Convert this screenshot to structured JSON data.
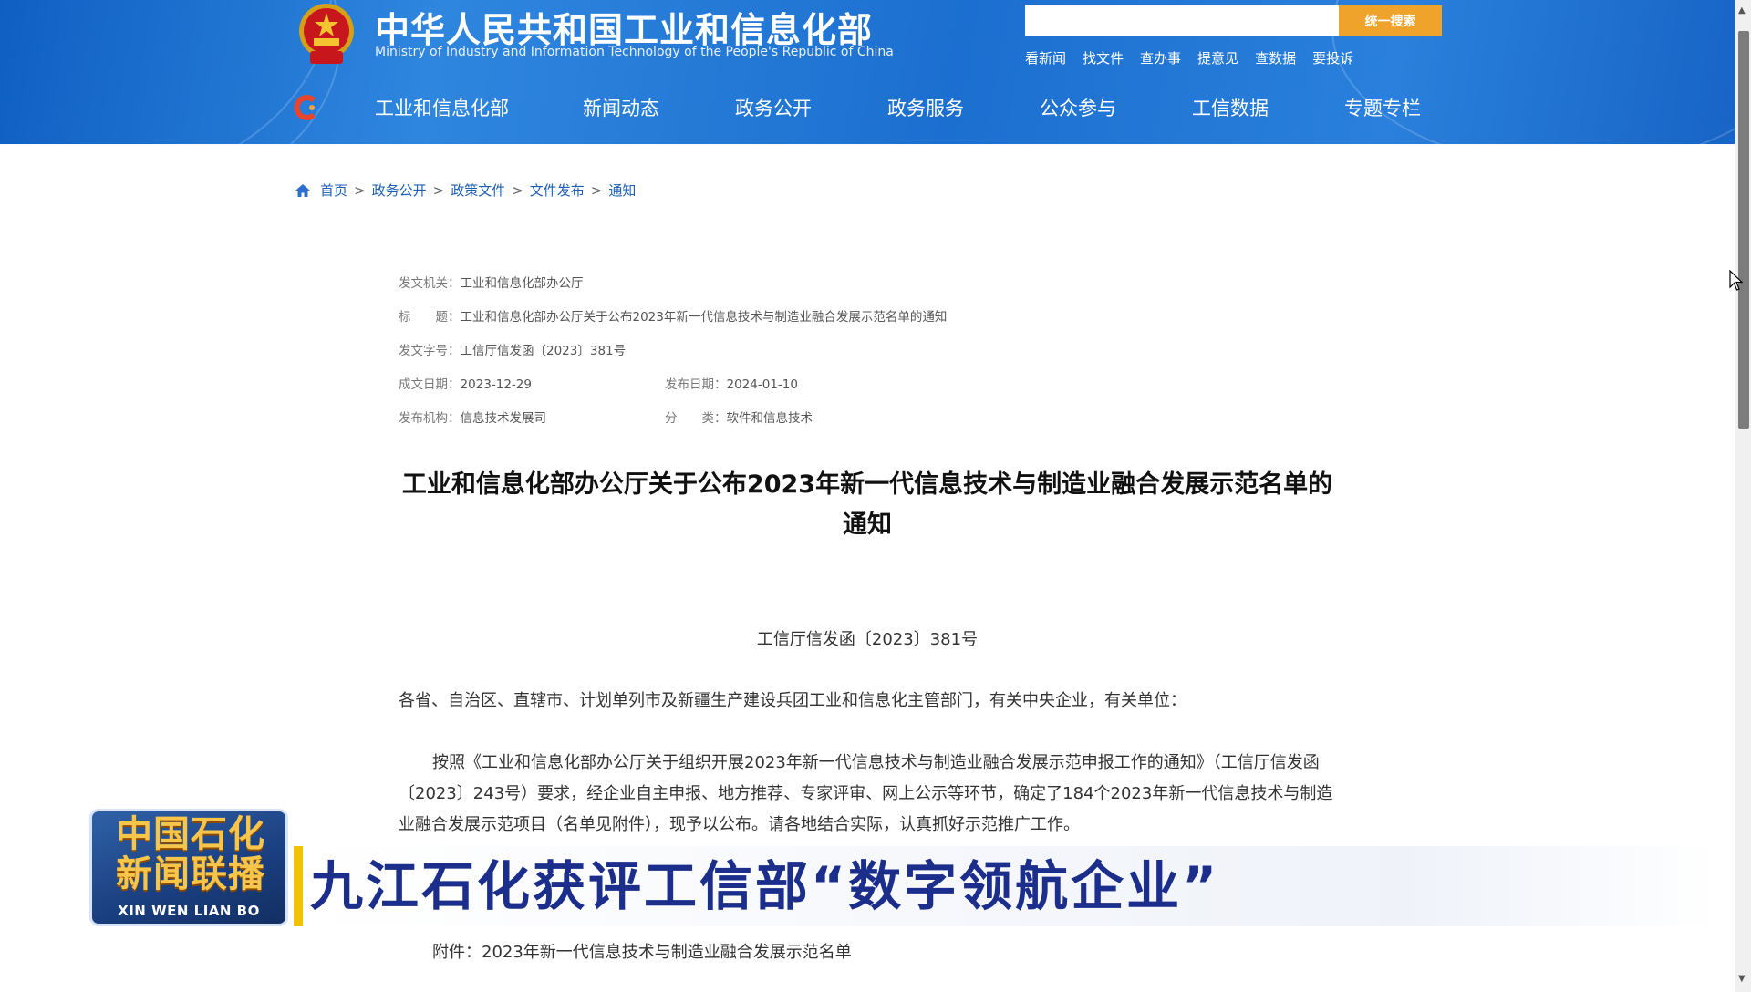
{
  "header": {
    "site_name_zh": "中华人民共和国工业和信息化部",
    "site_name_en": "Ministry of Industry and Information Technology of the People's Republic of China",
    "search": {
      "placeholder": "",
      "button_label": "统一搜索"
    },
    "quick_links": [
      "看新闻",
      "找文件",
      "查办事",
      "提意见",
      "查数据",
      "要投诉"
    ],
    "nav": [
      "工业和信息化部",
      "新闻动态",
      "政务公开",
      "政务服务",
      "公众参与",
      "工信数据",
      "专题专栏"
    ]
  },
  "breadcrumb": [
    "首页",
    "政务公开",
    "政策文件",
    "文件发布",
    "通知"
  ],
  "meta": {
    "issuer_label": "发文机关：",
    "issuer": "工业和信息化部办公厅",
    "title_label": "标　　题：",
    "title": "工业和信息化部办公厅关于公布2023年新一代信息技术与制造业融合发展示范名单的通知",
    "doc_no_label": "发文字号：",
    "doc_no": "工信厅信发函〔2023〕381号",
    "created_label": "成文日期：",
    "created": "2023-12-29",
    "published_label": "发布日期：",
    "published": "2024-01-10",
    "org_label": "发布机构：",
    "org": "信息技术发展司",
    "category_label": "分　　类：",
    "category": "软件和信息技术"
  },
  "article": {
    "title_line1": "工业和信息化部办公厅关于公布2023年新一代信息技术与制造业融合发展示范名单的",
    "title_line2": "通知",
    "doc_number": "工信厅信发函〔2023〕381号",
    "recipients": "各省、自治区、直辖市、计划单列市及新疆生产建设兵团工业和信息化主管部门，有关中央企业，有关单位：",
    "body": "按照《工业和信息化部办公厅关于组织开展2023年新一代信息技术与制造业融合发展示范申报工作的通知》（工信厅信发函〔2023〕243号）要求，经企业自主申报、地方推荐、专家评审、网上公示等环节，确定了184个2023年新一代信息技术与制造业融合发展示范项目（名单见附件），现予以公布。请各地结合实际，认真抓好示范推广工作。",
    "attachment": "附件：2023年新一代信息技术与制造业融合发展示范名单"
  },
  "overlay": {
    "program_zh_line1": "中国石化",
    "program_zh_line2": "新闻联播",
    "program_pinyin": "XIN WEN LIAN BO",
    "headline": "九江石化获评工信部“数字领航企业”"
  },
  "colors": {
    "header_blue": "#1c6fd0",
    "search_orange": "#f0a32a",
    "headline_blue": "#1b2e8c",
    "link_blue": "#1d5fb4",
    "accent_yellow": "#f2c200"
  }
}
